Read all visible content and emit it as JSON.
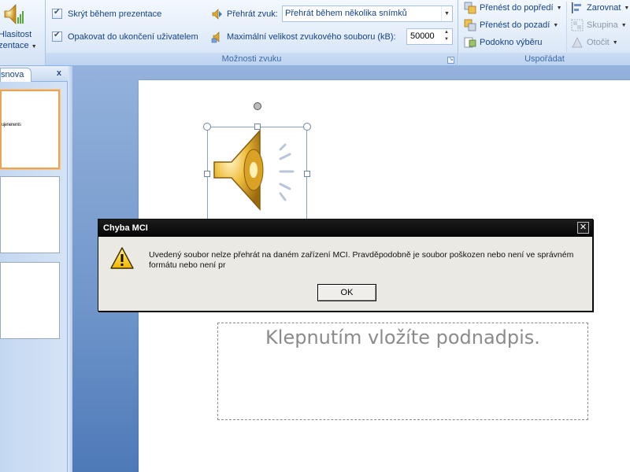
{
  "ribbon": {
    "volume_button": {
      "line1": "Hlasitost",
      "line2": "ezentace"
    },
    "sound_options": {
      "hide_during_show": "Skrýt během prezentace",
      "loop_until_stopped": "Opakovat do ukončení uživatelem",
      "play_sound_label": "Přehrát zvuk:",
      "play_sound_value": "Přehrát během několika snímků",
      "max_size_label": "Maximální velikost zvukového souboru (kB):",
      "max_size_value": "50000",
      "group_title": "Možnosti zvuku"
    },
    "arrange": {
      "bring_to_front": "Přenést do popředí",
      "send_to_back": "Přenést do pozadí",
      "selection_pane": "Podokno výběru",
      "align": "Zarovnat",
      "group": "Skupina",
      "rotate": "Otočit",
      "group_title": "Uspořádat"
    }
  },
  "left_pane": {
    "tab_label": "snova",
    "close_glyph": "x",
    "thumb1_text": "ujenenenís"
  },
  "slide": {
    "subtitle_placeholder": "Klepnutím vložíte podnadpis."
  },
  "dialog": {
    "title": "Chyba MCI",
    "close_glyph": "✕",
    "message": "Uvedený soubor nelze přehrát na daném zařízení MCI. Pravděpodobně je soubor poškozen nebo není ve správném formátu nebo není pr",
    "ok_label": "OK"
  },
  "colors": {
    "ribbon_text": "#15428b",
    "dialog_titlebar": "#0a0a0a",
    "selected_thumb_border": "#e8a357"
  }
}
